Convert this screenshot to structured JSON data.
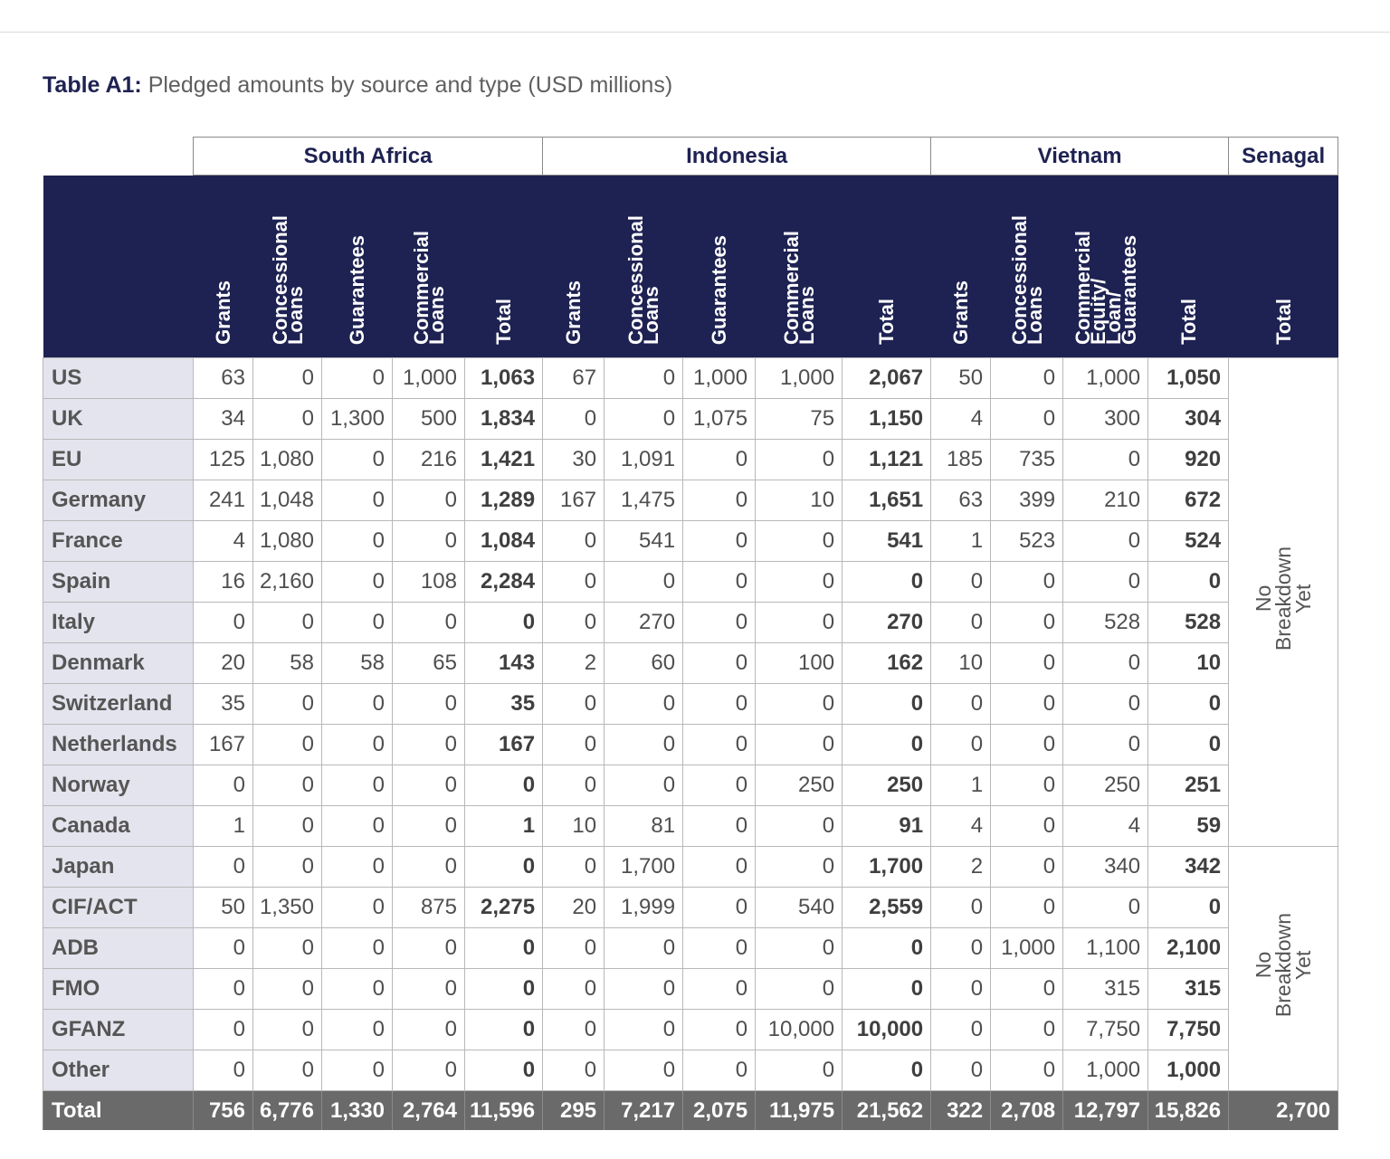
{
  "caption": {
    "label": "Table A1:",
    "text": "Pledged amounts by source and type (USD millions)"
  },
  "groups": [
    "South Africa",
    "Indonesia",
    "Vietnam",
    "Senagal"
  ],
  "subheaders": {
    "sa": [
      "Grants",
      "Concessional\nLoans",
      "Guarantees",
      "Commercial\nLoans",
      "Total"
    ],
    "id": [
      "Grants",
      "Concessional\nLoans",
      "Guarantees",
      "Commercial\nLoans",
      "Total"
    ],
    "vn": [
      "Grants",
      "Concessional\nLoans",
      "Commercial\nEquity/\nLoan/\nGuarantees",
      "Total"
    ],
    "sn": [
      "Total"
    ]
  },
  "no_breakdown_label": "No\nBreakdown\nYet",
  "rows": [
    {
      "label": "US",
      "sa": [
        "63",
        "0",
        "0",
        "1,000",
        "1,063"
      ],
      "id": [
        "67",
        "0",
        "1,000",
        "1,000",
        "2,067"
      ],
      "vn": [
        "50",
        "0",
        "1,000",
        "1,050"
      ]
    },
    {
      "label": "UK",
      "sa": [
        "34",
        "0",
        "1,300",
        "500",
        "1,834"
      ],
      "id": [
        "0",
        "0",
        "1,075",
        "75",
        "1,150"
      ],
      "vn": [
        "4",
        "0",
        "300",
        "304"
      ]
    },
    {
      "label": "EU",
      "sa": [
        "125",
        "1,080",
        "0",
        "216",
        "1,421"
      ],
      "id": [
        "30",
        "1,091",
        "0",
        "0",
        "1,121"
      ],
      "vn": [
        "185",
        "735",
        "0",
        "920"
      ]
    },
    {
      "label": "Germany",
      "sa": [
        "241",
        "1,048",
        "0",
        "0",
        "1,289"
      ],
      "id": [
        "167",
        "1,475",
        "0",
        "10",
        "1,651"
      ],
      "vn": [
        "63",
        "399",
        "210",
        "672"
      ]
    },
    {
      "label": "France",
      "sa": [
        "4",
        "1,080",
        "0",
        "0",
        "1,084"
      ],
      "id": [
        "0",
        "541",
        "0",
        "0",
        "541"
      ],
      "vn": [
        "1",
        "523",
        "0",
        "524"
      ]
    },
    {
      "label": "Spain",
      "sa": [
        "16",
        "2,160",
        "0",
        "108",
        "2,284"
      ],
      "id": [
        "0",
        "0",
        "0",
        "0",
        "0"
      ],
      "vn": [
        "0",
        "0",
        "0",
        "0"
      ]
    },
    {
      "label": "Italy",
      "sa": [
        "0",
        "0",
        "0",
        "0",
        "0"
      ],
      "id": [
        "0",
        "270",
        "0",
        "0",
        "270"
      ],
      "vn": [
        "0",
        "0",
        "528",
        "528"
      ]
    },
    {
      "label": "Denmark",
      "sa": [
        "20",
        "58",
        "58",
        "65",
        "143"
      ],
      "id": [
        "2",
        "60",
        "0",
        "100",
        "162"
      ],
      "vn": [
        "10",
        "0",
        "0",
        "10"
      ]
    },
    {
      "label": "Switzerland",
      "sa": [
        "35",
        "0",
        "0",
        "0",
        "35"
      ],
      "id": [
        "0",
        "0",
        "0",
        "0",
        "0"
      ],
      "vn": [
        "0",
        "0",
        "0",
        "0"
      ]
    },
    {
      "label": "Netherlands",
      "sa": [
        "167",
        "0",
        "0",
        "0",
        "167"
      ],
      "id": [
        "0",
        "0",
        "0",
        "0",
        "0"
      ],
      "vn": [
        "0",
        "0",
        "0",
        "0"
      ]
    },
    {
      "label": "Norway",
      "sa": [
        "0",
        "0",
        "0",
        "0",
        "0"
      ],
      "id": [
        "0",
        "0",
        "0",
        "250",
        "250"
      ],
      "vn": [
        "1",
        "0",
        "250",
        "251"
      ]
    },
    {
      "label": "Canada",
      "sa": [
        "1",
        "0",
        "0",
        "0",
        "1"
      ],
      "id": [
        "10",
        "81",
        "0",
        "0",
        "91"
      ],
      "vn": [
        "4",
        "0",
        "4",
        "59"
      ]
    },
    {
      "label": "Japan",
      "sa": [
        "0",
        "0",
        "0",
        "0",
        "0"
      ],
      "id": [
        "0",
        "1,700",
        "0",
        "0",
        "1,700"
      ],
      "vn": [
        "2",
        "0",
        "340",
        "342"
      ]
    },
    {
      "label": "CIF/ACT",
      "sa": [
        "50",
        "1,350",
        "0",
        "875",
        "2,275"
      ],
      "id": [
        "20",
        "1,999",
        "0",
        "540",
        "2,559"
      ],
      "vn": [
        "0",
        "0",
        "0",
        "0"
      ]
    },
    {
      "label": "ADB",
      "sa": [
        "0",
        "0",
        "0",
        "0",
        "0"
      ],
      "id": [
        "0",
        "0",
        "0",
        "0",
        "0"
      ],
      "vn": [
        "0",
        "1,000",
        "1,100",
        "2,100"
      ]
    },
    {
      "label": "FMO",
      "sa": [
        "0",
        "0",
        "0",
        "0",
        "0"
      ],
      "id": [
        "0",
        "0",
        "0",
        "0",
        "0"
      ],
      "vn": [
        "0",
        "0",
        "315",
        "315"
      ]
    },
    {
      "label": "GFANZ",
      "sa": [
        "0",
        "0",
        "0",
        "0",
        "0"
      ],
      "id": [
        "0",
        "0",
        "0",
        "10,000",
        "10,000"
      ],
      "vn": [
        "0",
        "0",
        "7,750",
        "7,750"
      ]
    },
    {
      "label": "Other",
      "sa": [
        "0",
        "0",
        "0",
        "0",
        "0"
      ],
      "id": [
        "0",
        "0",
        "0",
        "0",
        "0"
      ],
      "vn": [
        "0",
        "0",
        "1,000",
        "1,000"
      ]
    }
  ],
  "totals": {
    "label": "Total",
    "sa": [
      "756",
      "6,776",
      "1,330",
      "2,764",
      "11,596"
    ],
    "id": [
      "295",
      "7,217",
      "2,075",
      "11,975",
      "21,562"
    ],
    "vn": [
      "322",
      "2,708",
      "12,797",
      "15,826"
    ],
    "sn": [
      "2,700"
    ]
  }
}
